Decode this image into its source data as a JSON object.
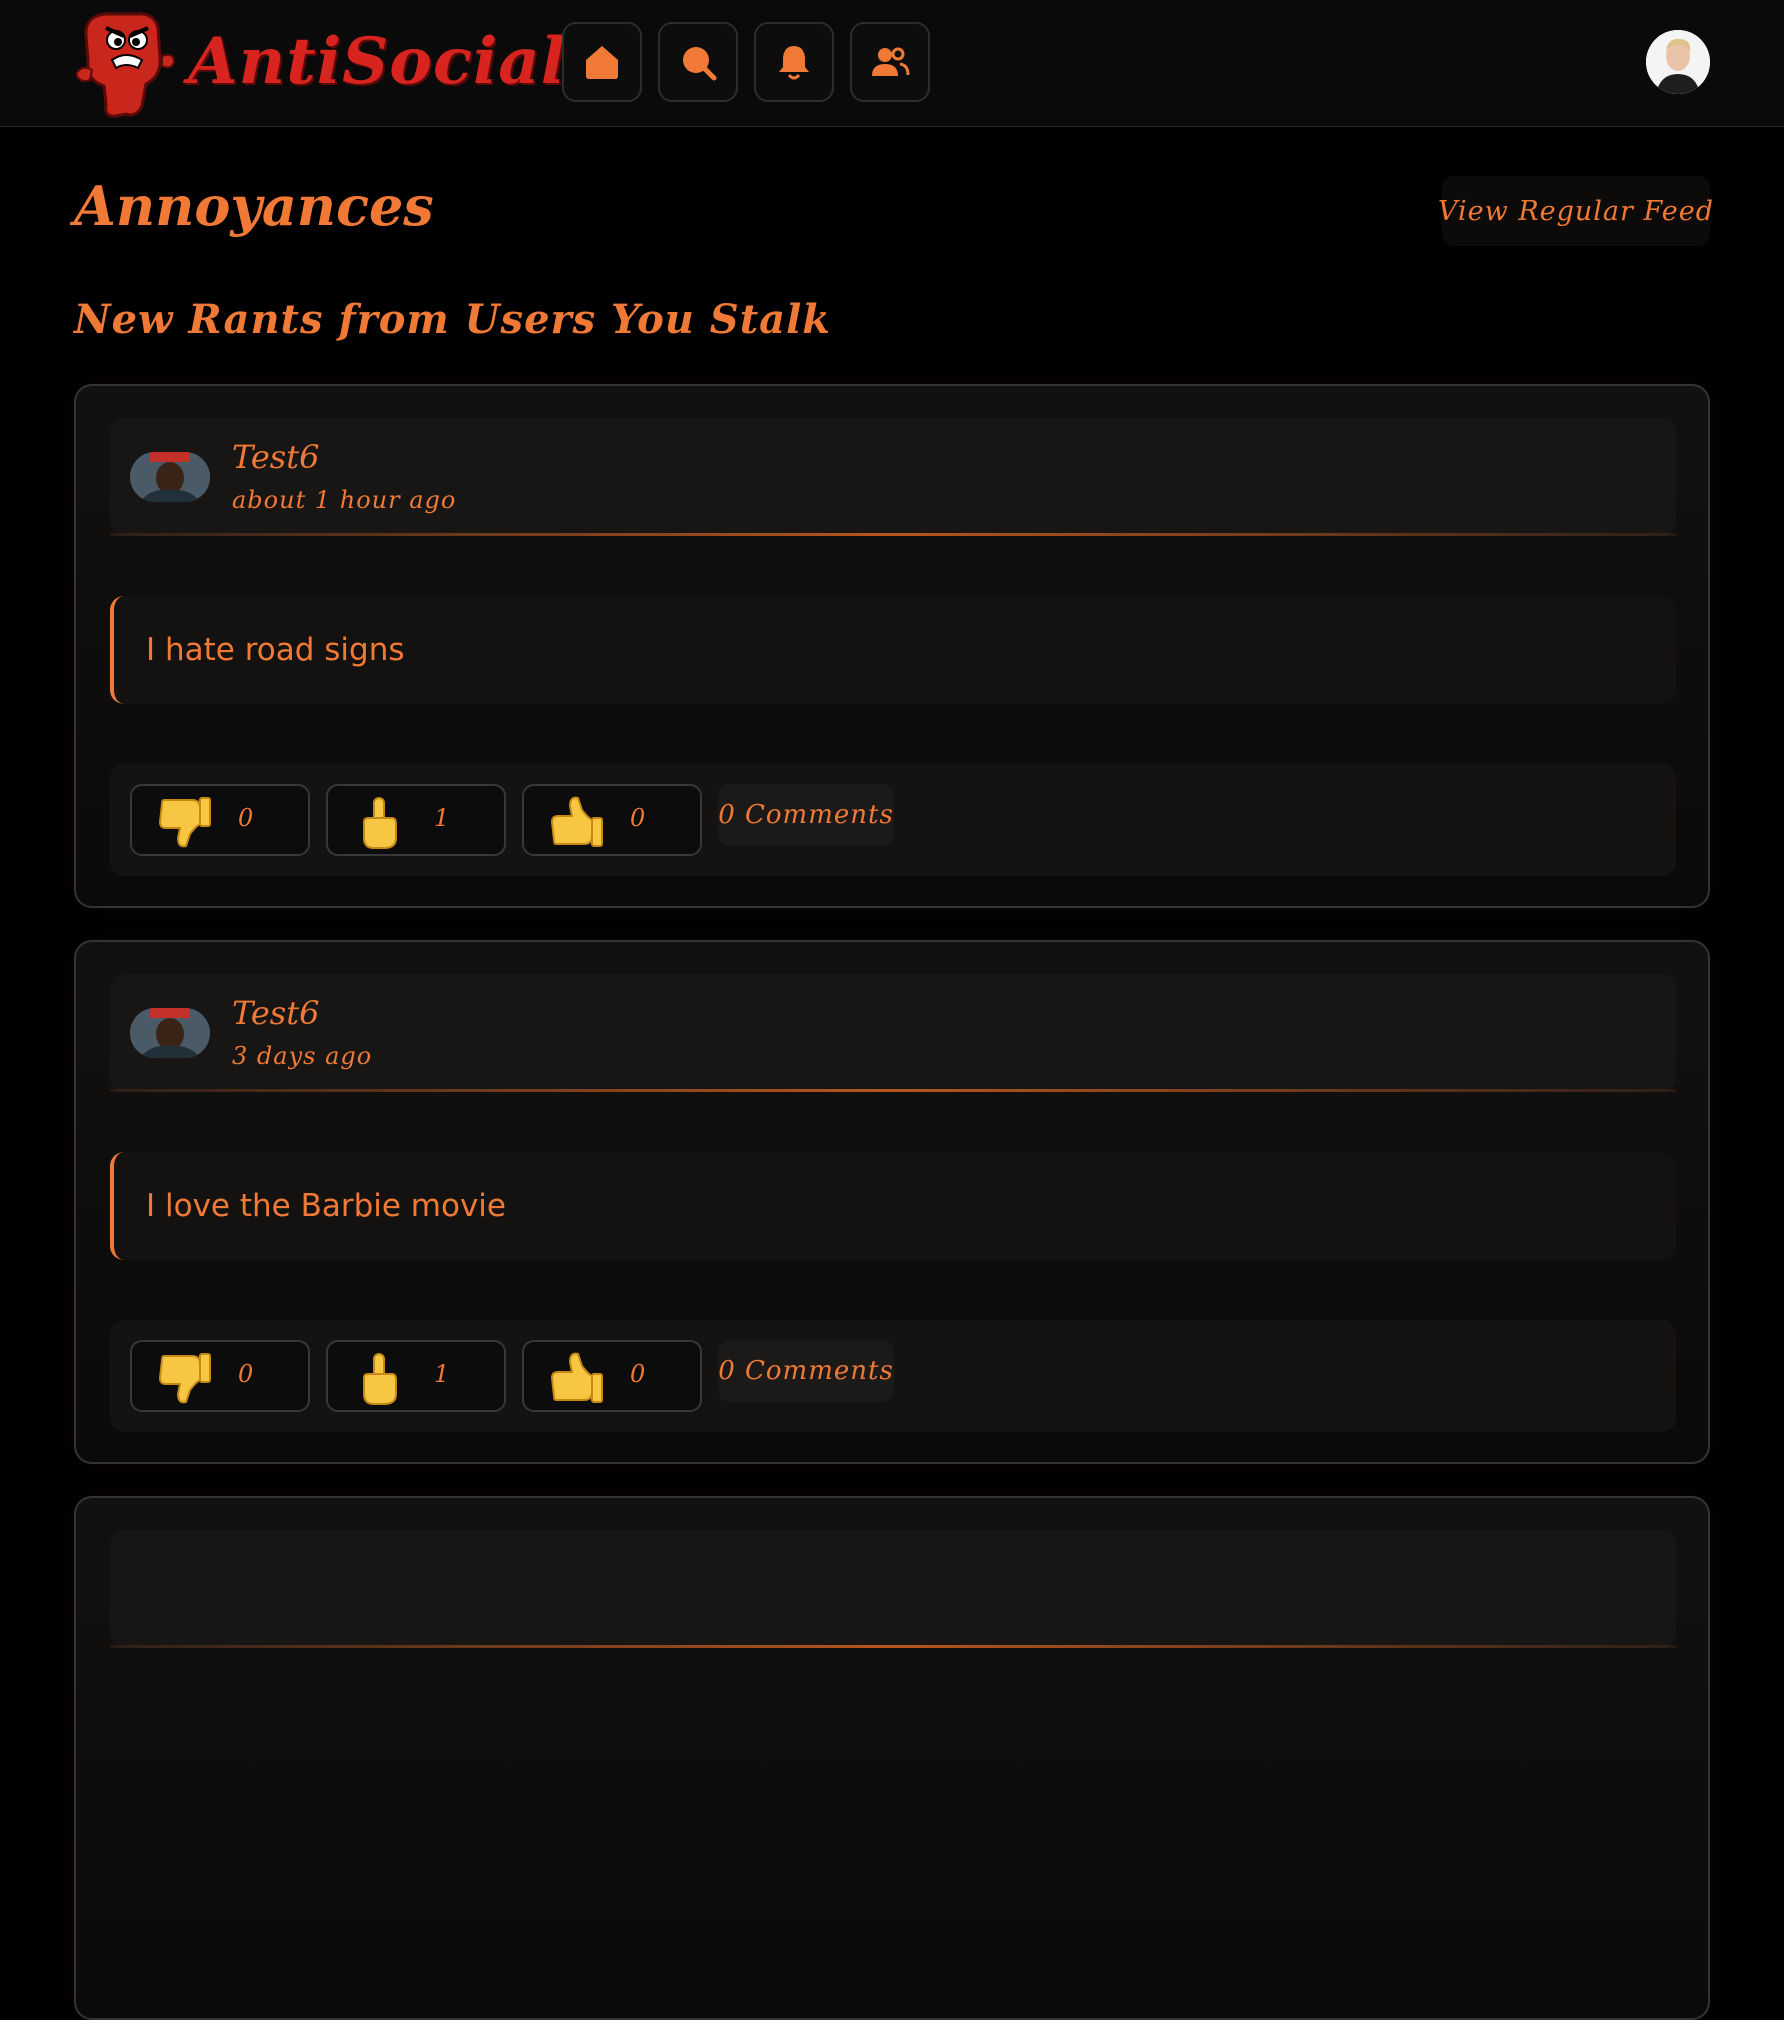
{
  "app": {
    "name": "AntiSocial",
    "accent_color": "#f07a35",
    "logo_color": "#d8241f"
  },
  "nav": [
    {
      "name": "home",
      "icon": "home-icon"
    },
    {
      "name": "search",
      "icon": "search-icon"
    },
    {
      "name": "notifications",
      "icon": "bell-icon"
    },
    {
      "name": "friends",
      "icon": "users-icon"
    }
  ],
  "page": {
    "title": "Annoyances",
    "view_regular_label": "View Regular Feed",
    "section_title": "New Rants from Users You Stalk"
  },
  "rants": [
    {
      "author": "Test6",
      "time": "about 1 hour ago",
      "text": "I hate road signs",
      "reactions": {
        "dislike": "0",
        "middle_finger": "1",
        "like": "0"
      },
      "comments_label": "0 Comments"
    },
    {
      "author": "Test6",
      "time": "3 days ago",
      "text": "I love the Barbie movie",
      "reactions": {
        "dislike": "0",
        "middle_finger": "1",
        "like": "0"
      },
      "comments_label": "0 Comments"
    }
  ]
}
